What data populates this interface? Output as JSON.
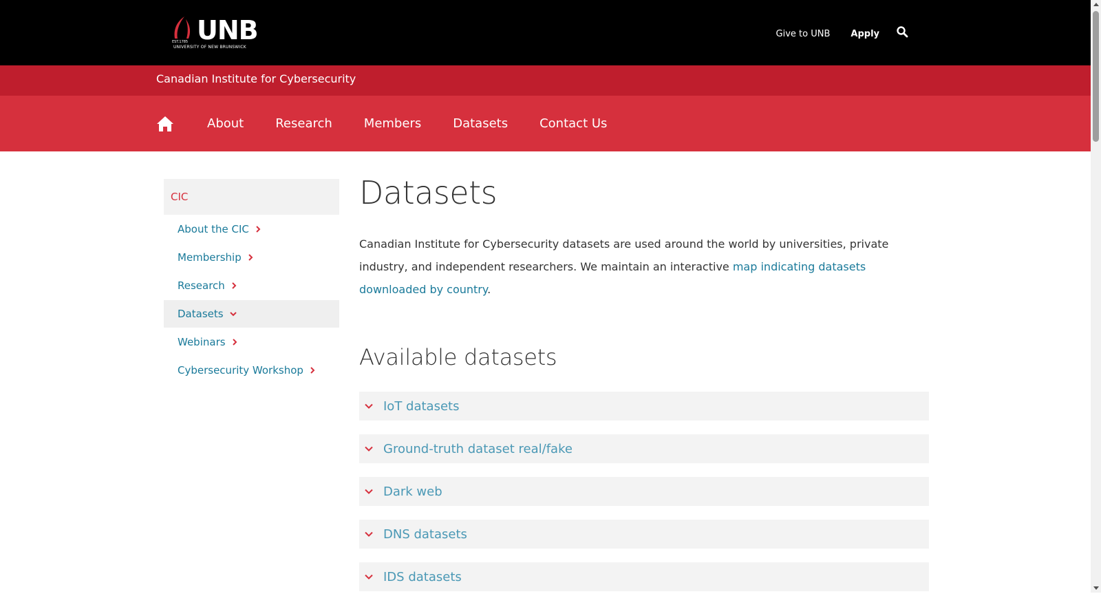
{
  "header": {
    "logo": {
      "wordmark": "UNB",
      "est": "EST.1785",
      "university": "UNIVERSITY OF NEW BRUNSWICK"
    },
    "links": [
      {
        "label": "Give to UNB"
      },
      {
        "label": "Apply"
      }
    ],
    "search_icon": "search-icon"
  },
  "site": {
    "name": "Canadian Institute for Cybersecurity"
  },
  "nav": {
    "home_icon": "home-icon",
    "items": [
      {
        "label": "About"
      },
      {
        "label": "Research"
      },
      {
        "label": "Members"
      },
      {
        "label": "Datasets"
      },
      {
        "label": "Contact Us"
      }
    ]
  },
  "sidebar": {
    "heading": "CIC",
    "items": [
      {
        "label": "About the CIC",
        "icon": "chevron-right-icon"
      },
      {
        "label": "Membership",
        "icon": "chevron-right-icon"
      },
      {
        "label": "Research",
        "icon": "chevron-right-icon"
      },
      {
        "label": "Datasets",
        "icon": "chevron-down-icon"
      },
      {
        "label": "Webinars",
        "icon": "chevron-right-icon"
      },
      {
        "label": "Cybersecurity Workshop",
        "icon": "chevron-right-icon"
      }
    ]
  },
  "main": {
    "title": "Datasets",
    "intro_text": "Canadian Institute for Cybersecurity datasets are used around the world by universities, private industry, and independent researchers. We maintain an interactive ",
    "intro_link": "map indicating datasets downloaded by country",
    "intro_end": ".",
    "section_title": "Available datasets",
    "accordion": [
      {
        "label": "IoT datasets"
      },
      {
        "label": "Ground-truth dataset real/fake"
      },
      {
        "label": "Dark web"
      },
      {
        "label": "DNS datasets"
      },
      {
        "label": "IDS datasets"
      }
    ]
  },
  "colors": {
    "black": "#000000",
    "red_dark": "#bf1e2d",
    "red": "#d6303d",
    "link": "#1a7a9a",
    "accordion_text": "#4a98b5"
  }
}
